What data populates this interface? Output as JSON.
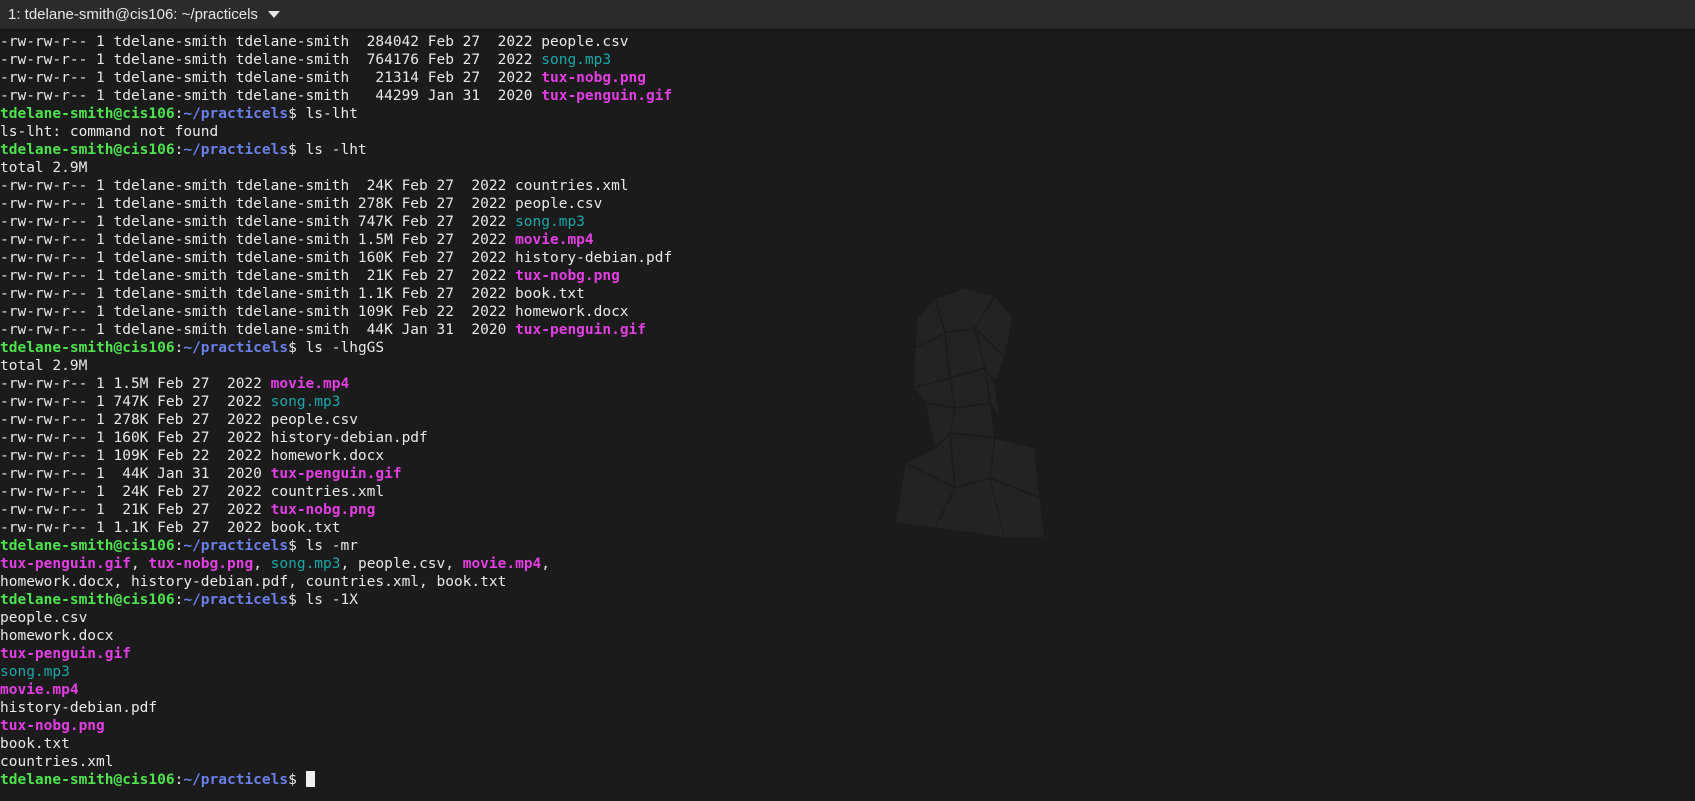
{
  "tab": {
    "title": "1: tdelane-smith@cis106: ~/practicels"
  },
  "colors": {
    "background": "#1b1b1b",
    "user": "#4ee34e",
    "path": "#6b7fe8",
    "executable_media": "#e33ee3",
    "audio": "#1aa7a7",
    "text": "#e8e8e8"
  },
  "terminal": {
    "lines": [
      [
        [
          "plain",
          "-rw-rw-r-- 1 tdelane-smith tdelane-smith  284042 Feb 27  2022 people.csv"
        ]
      ],
      [
        [
          "plain",
          "-rw-rw-r-- 1 tdelane-smith tdelane-smith  764176 Feb 27  2022 "
        ],
        [
          "cyan",
          "song.mp3"
        ]
      ],
      [
        [
          "plain",
          "-rw-rw-r-- 1 tdelane-smith tdelane-smith   21314 Feb 27  2022 "
        ],
        [
          "mag",
          "tux-nobg.png"
        ]
      ],
      [
        [
          "plain",
          "-rw-rw-r-- 1 tdelane-smith tdelane-smith   44299 Jan 31  2020 "
        ],
        [
          "mag",
          "tux-penguin.gif"
        ]
      ],
      [
        [
          "user",
          "tdelane-smith@cis106"
        ],
        [
          "plain",
          ":"
        ],
        [
          "path",
          "~/practicels"
        ],
        [
          "plain",
          "$ ls-lht"
        ]
      ],
      [
        [
          "plain",
          "ls-lht: command not found"
        ]
      ],
      [
        [
          "user",
          "tdelane-smith@cis106"
        ],
        [
          "plain",
          ":"
        ],
        [
          "path",
          "~/practicels"
        ],
        [
          "plain",
          "$ ls -lht"
        ]
      ],
      [
        [
          "plain",
          "total 2.9M"
        ]
      ],
      [
        [
          "plain",
          "-rw-rw-r-- 1 tdelane-smith tdelane-smith  24K Feb 27  2022 countries.xml"
        ]
      ],
      [
        [
          "plain",
          "-rw-rw-r-- 1 tdelane-smith tdelane-smith 278K Feb 27  2022 people.csv"
        ]
      ],
      [
        [
          "plain",
          "-rw-rw-r-- 1 tdelane-smith tdelane-smith 747K Feb 27  2022 "
        ],
        [
          "cyan",
          "song.mp3"
        ]
      ],
      [
        [
          "plain",
          "-rw-rw-r-- 1 tdelane-smith tdelane-smith 1.5M Feb 27  2022 "
        ],
        [
          "mag",
          "movie.mp4"
        ]
      ],
      [
        [
          "plain",
          "-rw-rw-r-- 1 tdelane-smith tdelane-smith 160K Feb 27  2022 history-debian.pdf"
        ]
      ],
      [
        [
          "plain",
          "-rw-rw-r-- 1 tdelane-smith tdelane-smith  21K Feb 27  2022 "
        ],
        [
          "mag",
          "tux-nobg.png"
        ]
      ],
      [
        [
          "plain",
          "-rw-rw-r-- 1 tdelane-smith tdelane-smith 1.1K Feb 27  2022 book.txt"
        ]
      ],
      [
        [
          "plain",
          "-rw-rw-r-- 1 tdelane-smith tdelane-smith 109K Feb 22  2022 homework.docx"
        ]
      ],
      [
        [
          "plain",
          "-rw-rw-r-- 1 tdelane-smith tdelane-smith  44K Jan 31  2020 "
        ],
        [
          "mag",
          "tux-penguin.gif"
        ]
      ],
      [
        [
          "user",
          "tdelane-smith@cis106"
        ],
        [
          "plain",
          ":"
        ],
        [
          "path",
          "~/practicels"
        ],
        [
          "plain",
          "$ ls -lhgGS"
        ]
      ],
      [
        [
          "plain",
          "total 2.9M"
        ]
      ],
      [
        [
          "plain",
          "-rw-rw-r-- 1 1.5M Feb 27  2022 "
        ],
        [
          "mag",
          "movie.mp4"
        ]
      ],
      [
        [
          "plain",
          "-rw-rw-r-- 1 747K Feb 27  2022 "
        ],
        [
          "cyan",
          "song.mp3"
        ]
      ],
      [
        [
          "plain",
          "-rw-rw-r-- 1 278K Feb 27  2022 people.csv"
        ]
      ],
      [
        [
          "plain",
          "-rw-rw-r-- 1 160K Feb 27  2022 history-debian.pdf"
        ]
      ],
      [
        [
          "plain",
          "-rw-rw-r-- 1 109K Feb 22  2022 homework.docx"
        ]
      ],
      [
        [
          "plain",
          "-rw-rw-r-- 1  44K Jan 31  2020 "
        ],
        [
          "mag",
          "tux-penguin.gif"
        ]
      ],
      [
        [
          "plain",
          "-rw-rw-r-- 1  24K Feb 27  2022 countries.xml"
        ]
      ],
      [
        [
          "plain",
          "-rw-rw-r-- 1  21K Feb 27  2022 "
        ],
        [
          "mag",
          "tux-nobg.png"
        ]
      ],
      [
        [
          "plain",
          "-rw-rw-r-- 1 1.1K Feb 27  2022 book.txt"
        ]
      ],
      [
        [
          "user",
          "tdelane-smith@cis106"
        ],
        [
          "plain",
          ":"
        ],
        [
          "path",
          "~/practicels"
        ],
        [
          "plain",
          "$ ls -mr"
        ]
      ],
      [
        [
          "mag",
          "tux-penguin.gif"
        ],
        [
          "plain",
          ", "
        ],
        [
          "mag",
          "tux-nobg.png"
        ],
        [
          "plain",
          ", "
        ],
        [
          "cyan",
          "song.mp3"
        ],
        [
          "plain",
          ", people.csv, "
        ],
        [
          "mag",
          "movie.mp4"
        ],
        [
          "plain",
          ","
        ]
      ],
      [
        [
          "plain",
          "homework.docx, history-debian.pdf, countries.xml, book.txt"
        ]
      ],
      [
        [
          "user",
          "tdelane-smith@cis106"
        ],
        [
          "plain",
          ":"
        ],
        [
          "path",
          "~/practicels"
        ],
        [
          "plain",
          "$ ls -1X"
        ]
      ],
      [
        [
          "plain",
          "people.csv"
        ]
      ],
      [
        [
          "plain",
          "homework.docx"
        ]
      ],
      [
        [
          "mag",
          "tux-penguin.gif"
        ]
      ],
      [
        [
          "cyan",
          "song.mp3"
        ]
      ],
      [
        [
          "mag",
          "movie.mp4"
        ]
      ],
      [
        [
          "plain",
          "history-debian.pdf"
        ]
      ],
      [
        [
          "mag",
          "tux-nobg.png"
        ]
      ],
      [
        [
          "plain",
          "book.txt"
        ]
      ],
      [
        [
          "plain",
          "countries.xml"
        ]
      ],
      [
        [
          "user",
          "tdelane-smith@cis106"
        ],
        [
          "plain",
          ":"
        ],
        [
          "path",
          "~/practicels"
        ],
        [
          "plain",
          "$ "
        ],
        [
          "cursor",
          ""
        ]
      ]
    ]
  }
}
